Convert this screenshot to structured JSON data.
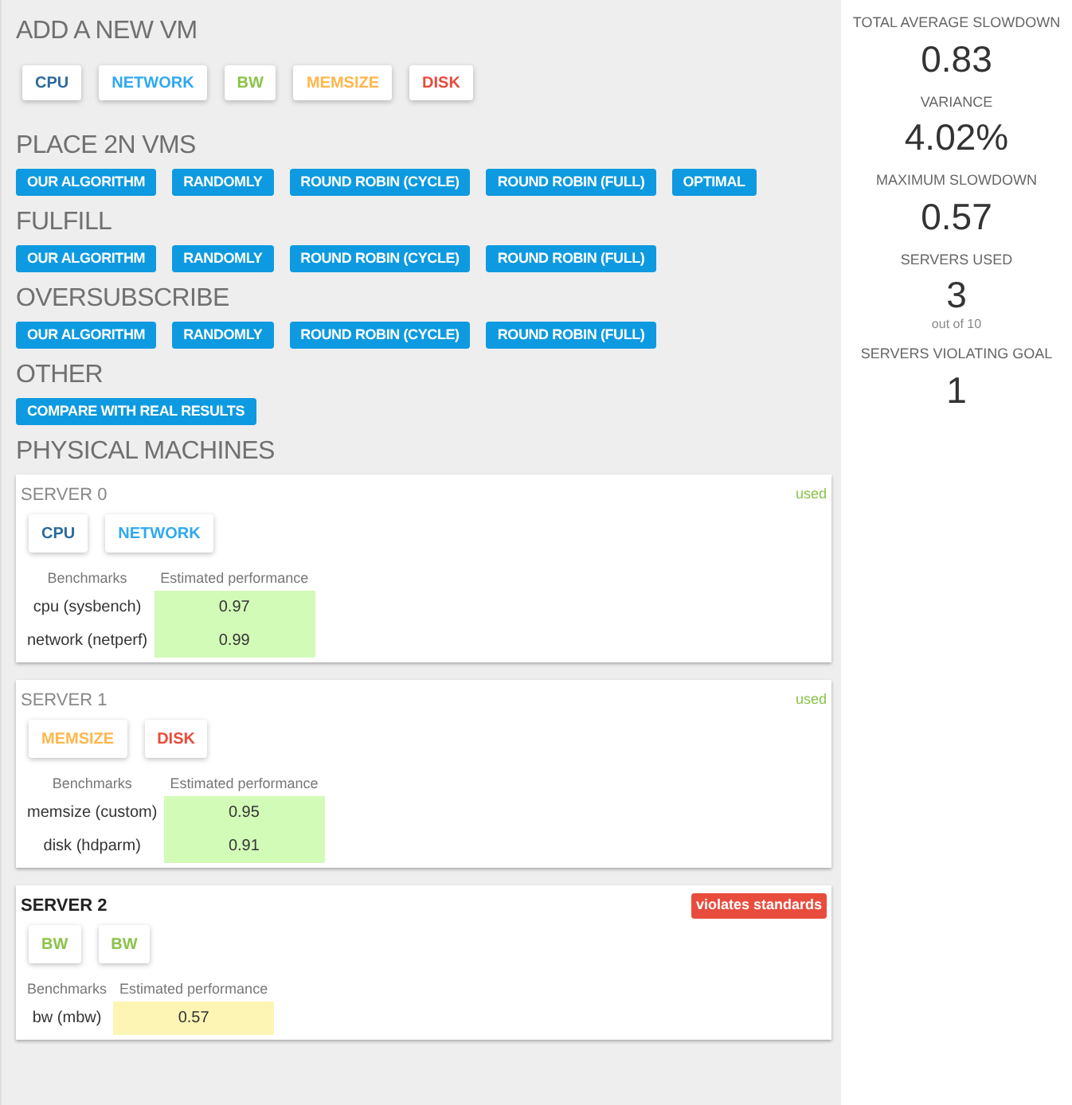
{
  "add_vm": {
    "title": "ADD A NEW VM",
    "vms": [
      {
        "label": "CPU",
        "color": "#2a6aa0"
      },
      {
        "label": "NETWORK",
        "color": "#2fa9f0"
      },
      {
        "label": "BW",
        "color": "#8bc34a"
      },
      {
        "label": "MEMSIZE",
        "color": "#ffb74d"
      },
      {
        "label": "DISK",
        "color": "#e84c3d"
      }
    ]
  },
  "sections": [
    {
      "title": "PLACE 2N VMS",
      "buttons": [
        "OUR ALGORITHM",
        "RANDOMLY",
        "ROUND ROBIN (CYCLE)",
        "ROUND ROBIN (FULL)",
        "OPTIMAL"
      ]
    },
    {
      "title": "FULFILL",
      "buttons": [
        "OUR ALGORITHM",
        "RANDOMLY",
        "ROUND ROBIN (CYCLE)",
        "ROUND ROBIN (FULL)"
      ]
    },
    {
      "title": "OVERSUBSCRIBE",
      "buttons": [
        "OUR ALGORITHM",
        "RANDOMLY",
        "ROUND ROBIN (CYCLE)",
        "ROUND ROBIN (FULL)"
      ]
    },
    {
      "title": "OTHER",
      "buttons": [
        "COMPARE WITH REAL RESULTS"
      ]
    }
  ],
  "physical_machines": {
    "title": "PHYSICAL MACHINES",
    "servers": [
      {
        "name": "SERVER 0",
        "status": {
          "kind": "used",
          "label": "used"
        },
        "vms": [
          {
            "label": "CPU",
            "color": "#2a6aa0"
          },
          {
            "label": "NETWORK",
            "color": "#2fa9f0"
          }
        ],
        "table": {
          "columns": [
            "Benchmarks",
            "Estimated performance"
          ],
          "rows": [
            {
              "benchmark": "cpu (sysbench)",
              "value": "0.97",
              "color": "#d3fbb8"
            },
            {
              "benchmark": "network (netperf)",
              "value": "0.99",
              "color": "#d3fbb8"
            }
          ]
        }
      },
      {
        "name": "SERVER 1",
        "status": {
          "kind": "used",
          "label": "used"
        },
        "vms": [
          {
            "label": "MEMSIZE",
            "color": "#ffb74d"
          },
          {
            "label": "DISK",
            "color": "#e84c3d"
          }
        ],
        "table": {
          "columns": [
            "Benchmarks",
            "Estimated performance"
          ],
          "rows": [
            {
              "benchmark": "memsize (custom)",
              "value": "0.95",
              "color": "#d3fbb8"
            },
            {
              "benchmark": "disk (hdparm)",
              "value": "0.91",
              "color": "#d3fbb8"
            }
          ]
        }
      },
      {
        "name": "SERVER 2",
        "status": {
          "kind": "violation",
          "label": "violates standards"
        },
        "vms": [
          {
            "label": "BW",
            "color": "#8bc34a"
          },
          {
            "label": "BW",
            "color": "#8bc34a"
          }
        ],
        "table": {
          "columns": [
            "Benchmarks",
            "Estimated performance"
          ],
          "rows": [
            {
              "benchmark": "bw (mbw)",
              "value": "0.57",
              "color": "#fcf5b4"
            }
          ]
        }
      }
    ]
  },
  "stats": [
    {
      "label": "TOTAL AVERAGE SLOWDOWN",
      "value": "0.83"
    },
    {
      "label": "VARIANCE",
      "value": "4.02%"
    },
    {
      "label": "MAXIMUM SLOWDOWN",
      "value": "0.57"
    },
    {
      "label": "SERVERS USED",
      "value": "3",
      "note": "out of 10"
    },
    {
      "label": "SERVERS VIOLATING GOAL",
      "value": "1"
    }
  ]
}
